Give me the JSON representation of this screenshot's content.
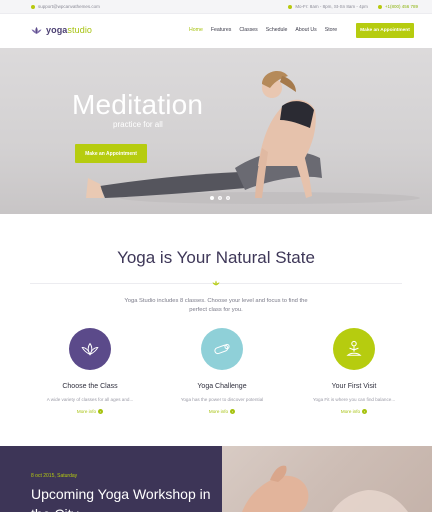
{
  "topbar": {
    "email": "support@wpcanvathemes.com",
    "hours": "Mo-Fr: 8am - 8pm, St-Sn 8am - 4pm",
    "phone": "+1(800) 456 789"
  },
  "header": {
    "logo_main": "yoga",
    "logo_accent": "studio",
    "nav": [
      "Home",
      "Features",
      "Classes",
      "Schedule",
      "About Us",
      "Store"
    ],
    "active_nav": "Home",
    "cta_label": "Make an Appointment"
  },
  "hero": {
    "title": "Meditation",
    "subtitle": "practice for all",
    "button_label": "Make an Appointment",
    "slide_count": 3,
    "active_slide": 1
  },
  "intro": {
    "title": "Yoga is Your Natural State",
    "description": "Yoga Studio includes 8 classes. Choose your level and focus to find the perfect class for you."
  },
  "features": [
    {
      "name": "Choose the Class",
      "text": "A wide variety of classes for all ages and...",
      "more": "More info",
      "icon": "lotus-icon",
      "color": "#5b4a8a"
    },
    {
      "name": "Yoga Challenge",
      "text": "Yoga has the power to discover potential",
      "more": "More info",
      "icon": "yoga-mat-icon",
      "color": "#8fd0d8"
    },
    {
      "name": "Your First Visit",
      "text": "Yoga Fit is where you can find balance...",
      "more": "More info",
      "icon": "meditation-icon",
      "color": "#b6cc0f"
    }
  ],
  "event": {
    "date": "8 oct 2015, Saturday",
    "title": "Upcoming Yoga Workshop in the City"
  },
  "colors": {
    "accent": "#b6cc0f",
    "brand": "#4b3f72",
    "dark_panel": "#3d3557"
  }
}
